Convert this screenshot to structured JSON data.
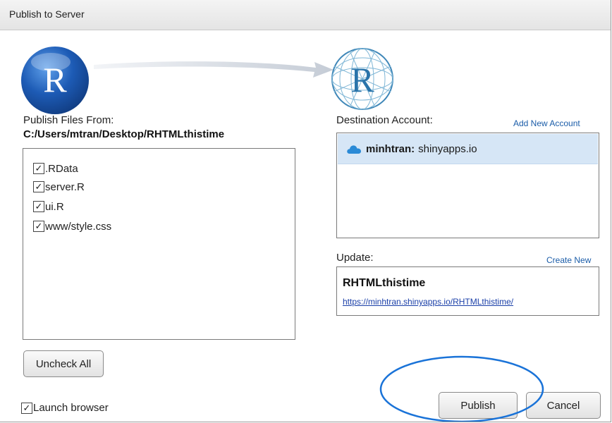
{
  "window": {
    "title": "Publish to Server"
  },
  "icons": {
    "source_logo": "r-logo-icon",
    "destination_logo": "r-logo-globe-icon",
    "transfer_arrow": "arrow-right-icon",
    "account_icon": "cloud-icon",
    "checkbox": "checkmark-icon",
    "logo_letter": "R"
  },
  "colors": {
    "selection": "#d6e6f6",
    "link": "#1a5ca8",
    "highlight_ellipse": "#1a73d8",
    "r_logo_blue": "#1d5bb5"
  },
  "source": {
    "label": "Publish Files From:",
    "path": "C:/Users/mtran/Desktop/RHTMLthistime",
    "files": [
      {
        "name": ".RData",
        "checked": true
      },
      {
        "name": "server.R",
        "checked": true
      },
      {
        "name": "ui.R",
        "checked": true
      },
      {
        "name": "www/style.css",
        "checked": true
      }
    ],
    "uncheck_all_label": "Uncheck All"
  },
  "destination": {
    "label": "Destination Account:",
    "add_account_label": "Add New Account",
    "accounts": [
      {
        "name": "minhtran:",
        "server": "shinyapps.io",
        "selected": true
      }
    ]
  },
  "update": {
    "label": "Update:",
    "create_new_label": "Create New",
    "app_name": "RHTMLthistime",
    "app_url": "https://minhtran.shinyapps.io/RHTMLthistime/"
  },
  "footer": {
    "launch_browser_label": "Launch browser",
    "launch_browser_checked": true,
    "publish_label": "Publish",
    "cancel_label": "Cancel"
  }
}
